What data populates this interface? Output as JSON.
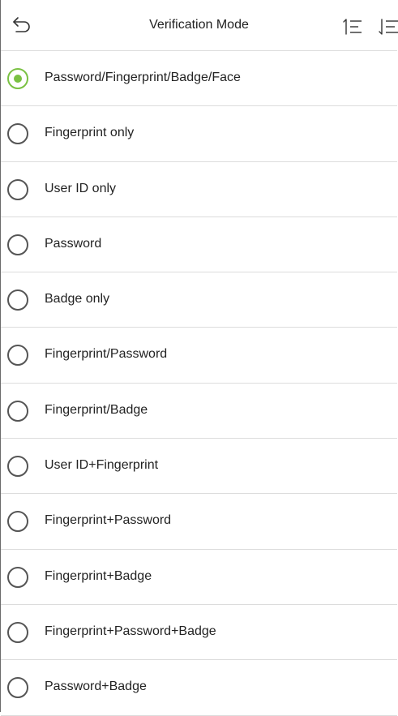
{
  "header": {
    "title": "Verification Mode",
    "back_icon": "back-arrow-icon",
    "sort_asc_icon": "sort-ascending-icon",
    "sort_desc_icon": "sort-descending-icon"
  },
  "colors": {
    "accent": "#7ac143",
    "divider": "#dcdcdc",
    "radio_border": "#555555"
  },
  "options": [
    {
      "label": "Password/Fingerprint/Badge/Face",
      "selected": true
    },
    {
      "label": "Fingerprint only",
      "selected": false
    },
    {
      "label": "User ID only",
      "selected": false
    },
    {
      "label": "Password",
      "selected": false
    },
    {
      "label": "Badge only",
      "selected": false
    },
    {
      "label": "Fingerprint/Password",
      "selected": false
    },
    {
      "label": "Fingerprint/Badge",
      "selected": false
    },
    {
      "label": "User ID+Fingerprint",
      "selected": false
    },
    {
      "label": "Fingerprint+Password",
      "selected": false
    },
    {
      "label": "Fingerprint+Badge",
      "selected": false
    },
    {
      "label": "Fingerprint+Password+Badge",
      "selected": false
    },
    {
      "label": "Password+Badge",
      "selected": false
    }
  ]
}
